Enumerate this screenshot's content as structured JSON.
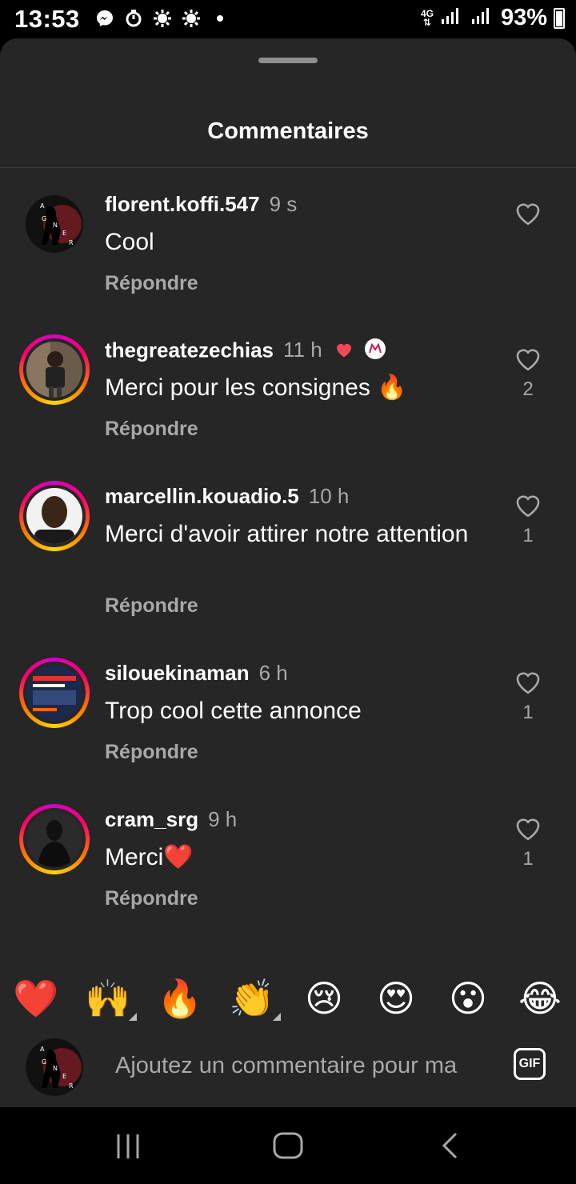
{
  "status_bar": {
    "time": "13:53",
    "network": "4G",
    "battery": "93%",
    "icons": [
      "messenger-icon",
      "timer-icon",
      "weather-icon",
      "weather-icon",
      "dot-icon"
    ]
  },
  "sheet": {
    "title": "Commentaires"
  },
  "comments": [
    {
      "username": "florent.koffi.547",
      "time": "9 s",
      "text": "Cool",
      "reply": "Répondre",
      "likes": ""
    },
    {
      "username": "thegreatezechias",
      "time": "11 h",
      "text": "Merci pour les consignes 🔥",
      "reply": "Répondre",
      "likes": "2"
    },
    {
      "username": "marcellin.kouadio.5",
      "time": "10 h",
      "text": "Merci d'avoir attirer notre attention",
      "reply": "Répondre",
      "likes": "1"
    },
    {
      "username": "silouekinaman",
      "time": "6 h",
      "text": "Trop cool cette annonce",
      "reply": "Répondre",
      "likes": "1"
    },
    {
      "username": "cram_srg",
      "time": "9 h",
      "text": "Merci❤️",
      "reply": "Répondre",
      "likes": "1"
    }
  ],
  "quick_reactions": [
    "❤️",
    "🙌",
    "🔥",
    "👏",
    "😢",
    "😍",
    "😮",
    "😂"
  ],
  "composer": {
    "placeholder": "Ajoutez un commentaire pour ma",
    "gif_label": "GIF"
  },
  "colors": {
    "sheet_bg": "#262626",
    "muted_text": "#a8a8a8",
    "heart_red": "#ed4956"
  }
}
